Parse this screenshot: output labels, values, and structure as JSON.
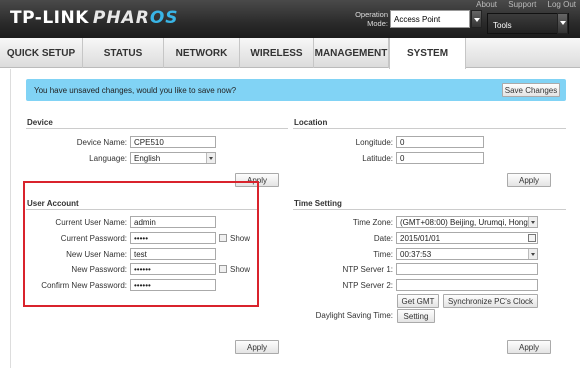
{
  "header": {
    "brand": "TP-LINK",
    "product_prefix": "PHAR",
    "product_suffix": "OS",
    "links": [
      "About",
      "Support",
      "Log Out"
    ],
    "opmode_label_line1": "Operation",
    "opmode_label_line2": "Mode:",
    "opmode_value": "Access Point",
    "tools_label": "Tools"
  },
  "nav": {
    "tabs": [
      "QUICK SETUP",
      "STATUS",
      "NETWORK",
      "WIRELESS",
      "MANAGEMENT",
      "SYSTEM"
    ],
    "active": "SYSTEM"
  },
  "banner": {
    "message": "You have unsaved changes, would you like to save now?",
    "save_label": "Save Changes"
  },
  "device": {
    "title": "Device",
    "name_label": "Device Name:",
    "name_value": "CPE510",
    "language_label": "Language:",
    "language_value": "English",
    "apply_label": "Apply"
  },
  "location": {
    "title": "Location",
    "longitude_label": "Longitude:",
    "longitude_value": "0",
    "latitude_label": "Latitude:",
    "latitude_value": "0",
    "apply_label": "Apply"
  },
  "user_account": {
    "title": "User Account",
    "current_user_label": "Current User Name:",
    "current_user_value": "admin",
    "current_password_label": "Current Password:",
    "current_password_value": "•••••",
    "show_label": "Show",
    "new_user_label": "New User Name:",
    "new_user_value": "test",
    "new_password_label": "New Password:",
    "new_password_value": "••••••",
    "confirm_password_label": "Confirm New Password:",
    "confirm_password_value": "••••••",
    "apply_label": "Apply"
  },
  "time_setting": {
    "title": "Time Setting",
    "timezone_label": "Time Zone:",
    "timezone_value": "(GMT+08:00) Beijing, Urumqi, Hong",
    "date_label": "Date:",
    "date_value": "2015/01/01",
    "time_label": "Time:",
    "time_value": "00:37:53",
    "ntp1_label": "NTP Server 1:",
    "ntp1_value": "",
    "ntp2_label": "NTP Server 2:",
    "ntp2_value": "",
    "get_gmt_label": "Get GMT",
    "sync_label": "Synchronize PC's Clock",
    "dst_label": "Daylight Saving Time:",
    "dst_button_label": "Setting",
    "apply_label": "Apply"
  },
  "colors": {
    "banner": "#81d3f5",
    "highlight_box": "#d9232c",
    "header": "#2b2b2b",
    "brand_accent": "#39b5e6"
  }
}
